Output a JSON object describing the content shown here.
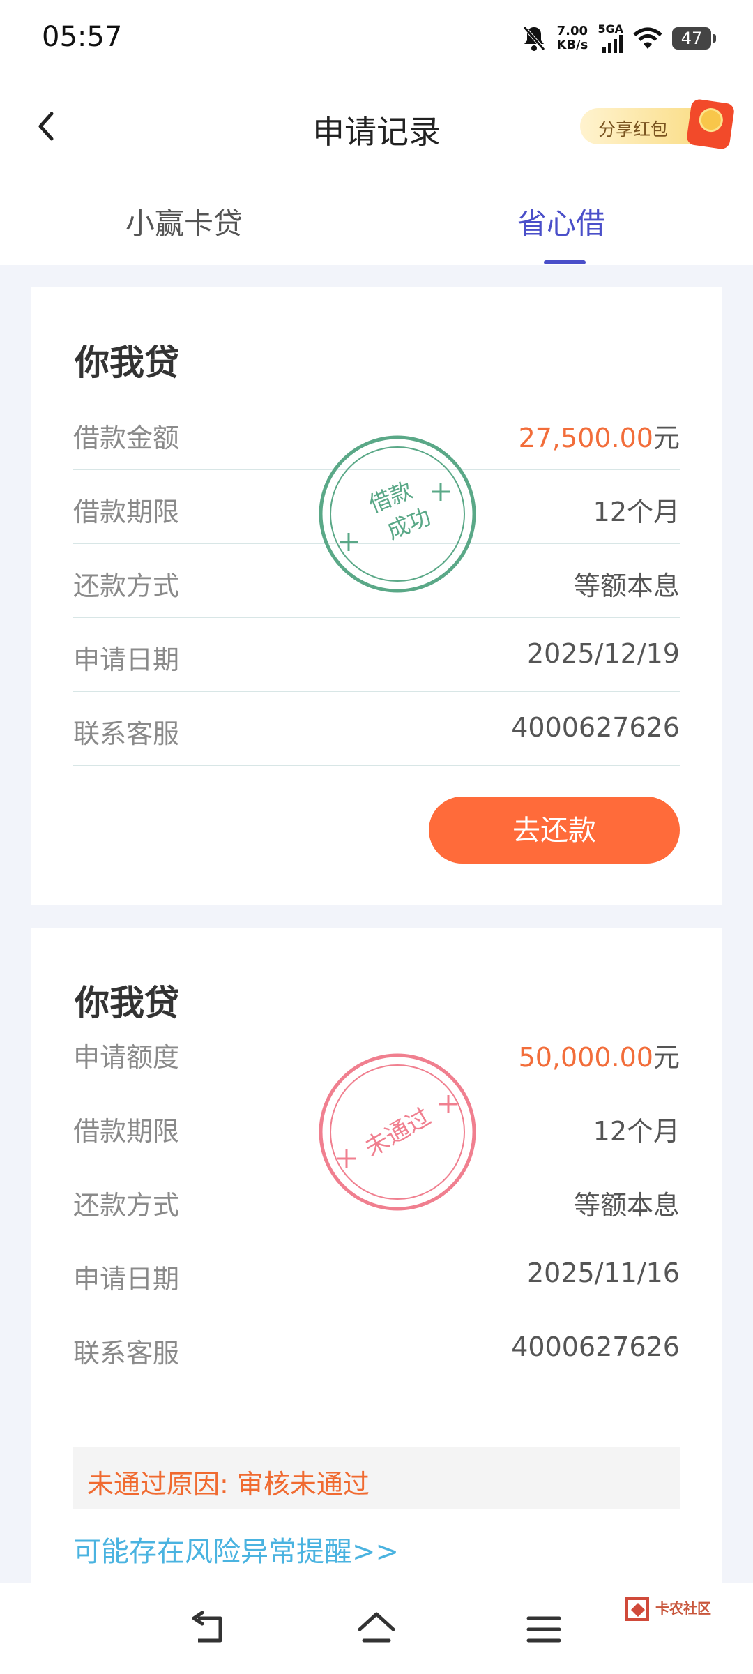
{
  "status_bar": {
    "time": "05:57",
    "net_speed_value": "7.00",
    "net_speed_unit": "KB/s",
    "network": "5GA",
    "battery": "47"
  },
  "header": {
    "title": "申请记录",
    "share_label": "分享红包"
  },
  "tabs": [
    {
      "label": "小赢卡贷",
      "active": false
    },
    {
      "label": "省心借",
      "active": true
    }
  ],
  "records": [
    {
      "title": "你我贷",
      "stamp": {
        "line1": "借款",
        "line2": "成功",
        "color": "#5aa887"
      },
      "rows": [
        {
          "label": "借款金额",
          "value": "27,500.00",
          "unit": "元"
        },
        {
          "label": "借款期限",
          "value": "12个月"
        },
        {
          "label": "还款方式",
          "value": "等额本息"
        },
        {
          "label": "申请日期",
          "value": "2025/12/19"
        },
        {
          "label": "联系客服",
          "value": "4000627626"
        }
      ],
      "action_label": "去还款"
    },
    {
      "title": "你我贷",
      "stamp": {
        "text": "未通过",
        "color": "#f07f8f"
      },
      "rows": [
        {
          "label": "申请额度",
          "value": "50,000.00",
          "unit": "元"
        },
        {
          "label": "借款期限",
          "value": "12个月"
        },
        {
          "label": "还款方式",
          "value": "等额本息"
        },
        {
          "label": "申请日期",
          "value": "2025/11/16"
        },
        {
          "label": "联系客服",
          "value": "4000627626"
        }
      ],
      "reason": "未通过原因: 审核未通过",
      "risk_link": "可能存在风险异常提醒>>"
    }
  ],
  "watermark": {
    "text": "卡农社区"
  },
  "colors": {
    "accent": "#4a4fc9",
    "amount": "#f26d3a",
    "button": "#ff6b3a",
    "link": "#4ab3e0"
  }
}
